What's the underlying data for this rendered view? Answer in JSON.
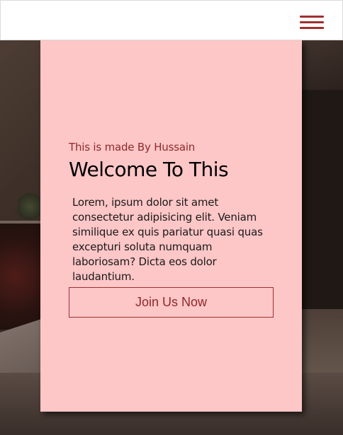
{
  "navbar": {
    "menu_icon": "hamburger-menu-icon",
    "menu_color": "#a0302f"
  },
  "hero": {
    "background": "laptop-desk-photo"
  },
  "card": {
    "background_color": "#fdc6c7",
    "subtitle": "This is made By Hussain",
    "title": "Welcome To This",
    "paragraph": "Lorem, ipsum dolor sit amet consectetur adipisicing elit. Veniam similique ex quis pariatur quasi quas excepturi soluta numquam laboriosam? Dicta eos dolor laudantium.",
    "cta_label": "Join Us Now",
    "accent_color": "#8f2a2a"
  }
}
